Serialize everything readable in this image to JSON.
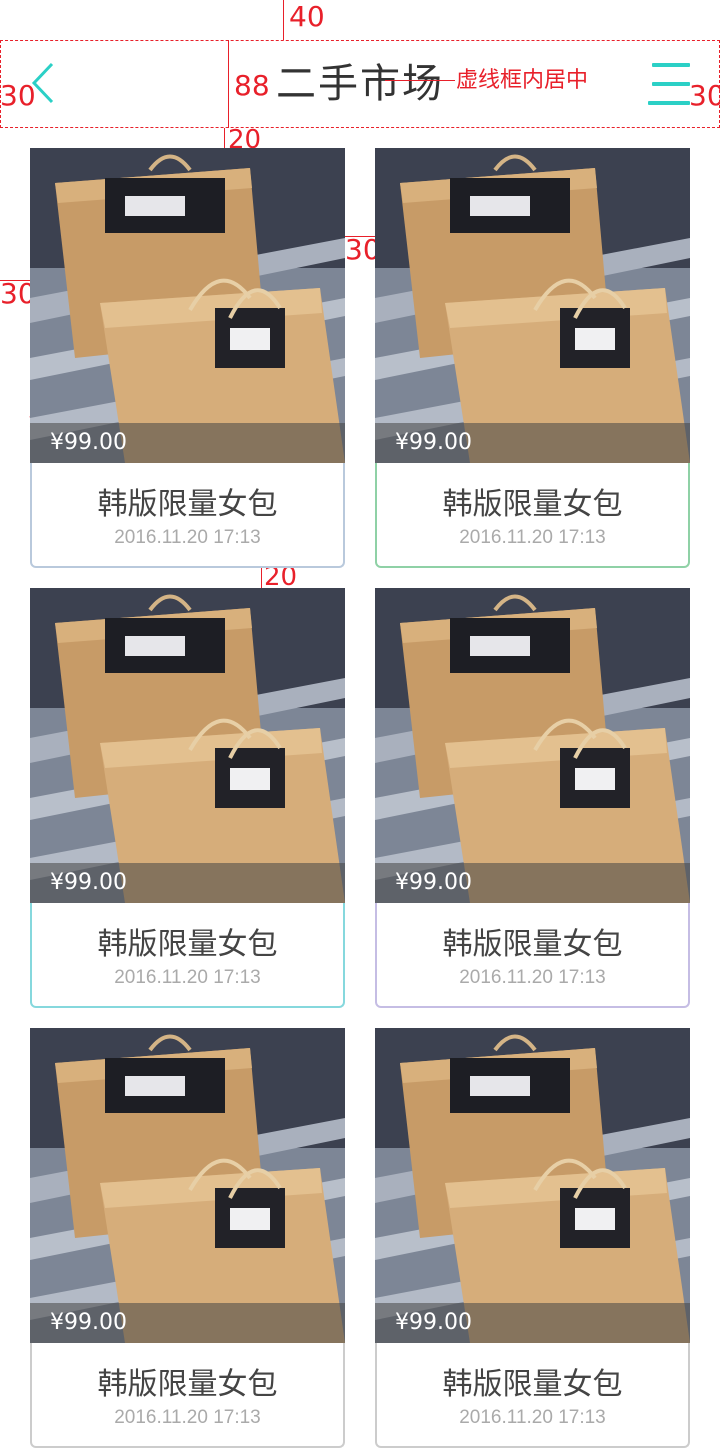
{
  "header": {
    "title": "二手市场",
    "back_icon": "chevron-left-icon",
    "menu_icon": "menu-icon",
    "accent_color": "#2bd0c6"
  },
  "annotations": {
    "top_margin": "40",
    "header_height": "88",
    "left_margin": "30",
    "right_margin": "30",
    "title_note": "虚线框内居中",
    "gap_below_header": "20",
    "image_padding": "30",
    "grid_gap": "30",
    "price_indent": "10",
    "price_height": "40",
    "name_gap": "20",
    "time_gap": "20",
    "bottom_gap": "20",
    "row_gap": "20",
    "color": "#e8202a"
  },
  "products": [
    {
      "price": "¥99.00",
      "name": "韩版限量女包",
      "time": "2016.11.20 17:13",
      "border_color": "#b9c9dc"
    },
    {
      "price": "¥99.00",
      "name": "韩版限量女包",
      "time": "2016.11.20 17:13",
      "border_color": "#8fd1a6"
    },
    {
      "price": "¥99.00",
      "name": "韩版限量女包",
      "time": "2016.11.20 17:13",
      "border_color": "#86d8dd"
    },
    {
      "price": "¥99.00",
      "name": "韩版限量女包",
      "time": "2016.11.20 17:13",
      "border_color": "#c5bde4"
    },
    {
      "price": "¥99.00",
      "name": "韩版限量女包",
      "time": "2016.11.20 17:13",
      "border_color": "#cccccc"
    },
    {
      "price": "¥99.00",
      "name": "韩版限量女包",
      "time": "2016.11.20 17:13",
      "border_color": "#cccccc"
    }
  ]
}
